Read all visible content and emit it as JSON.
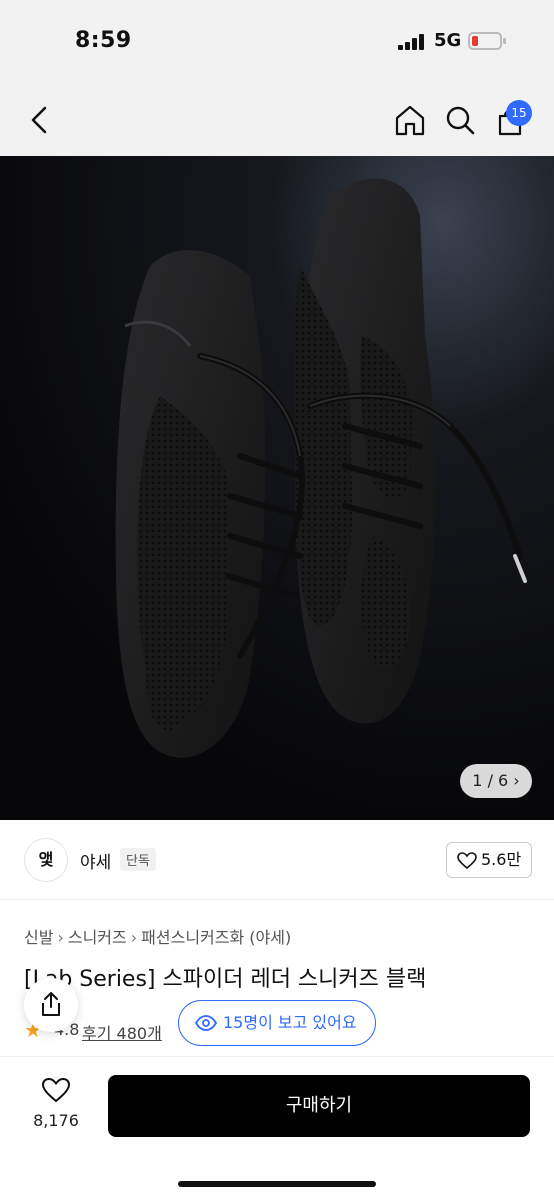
{
  "status": {
    "time": "8:59",
    "network": "5G"
  },
  "nav": {
    "cart_count": "15"
  },
  "gallery": {
    "counter": "1 / 6 ›"
  },
  "seller": {
    "logo_text": "앷",
    "name": "야세",
    "tag": "단독",
    "likes": "5.6만"
  },
  "breadcrumb": [
    "신발",
    "스니커즈",
    "패션스니커즈화 (야세)"
  ],
  "product": {
    "title": "[Lab Series] 스파이더 레더 스니커즈 블랙",
    "rating": "4.8",
    "reviews": "후기 480개"
  },
  "viewers": {
    "text": "15명이 보고 있어요"
  },
  "bottom": {
    "wish_count": "8,176",
    "buy_label": "구매하기"
  },
  "colors": {
    "accent": "#2f6bff",
    "buy": "#000000",
    "badge": "#2f6bff",
    "star": "#f5a623"
  }
}
